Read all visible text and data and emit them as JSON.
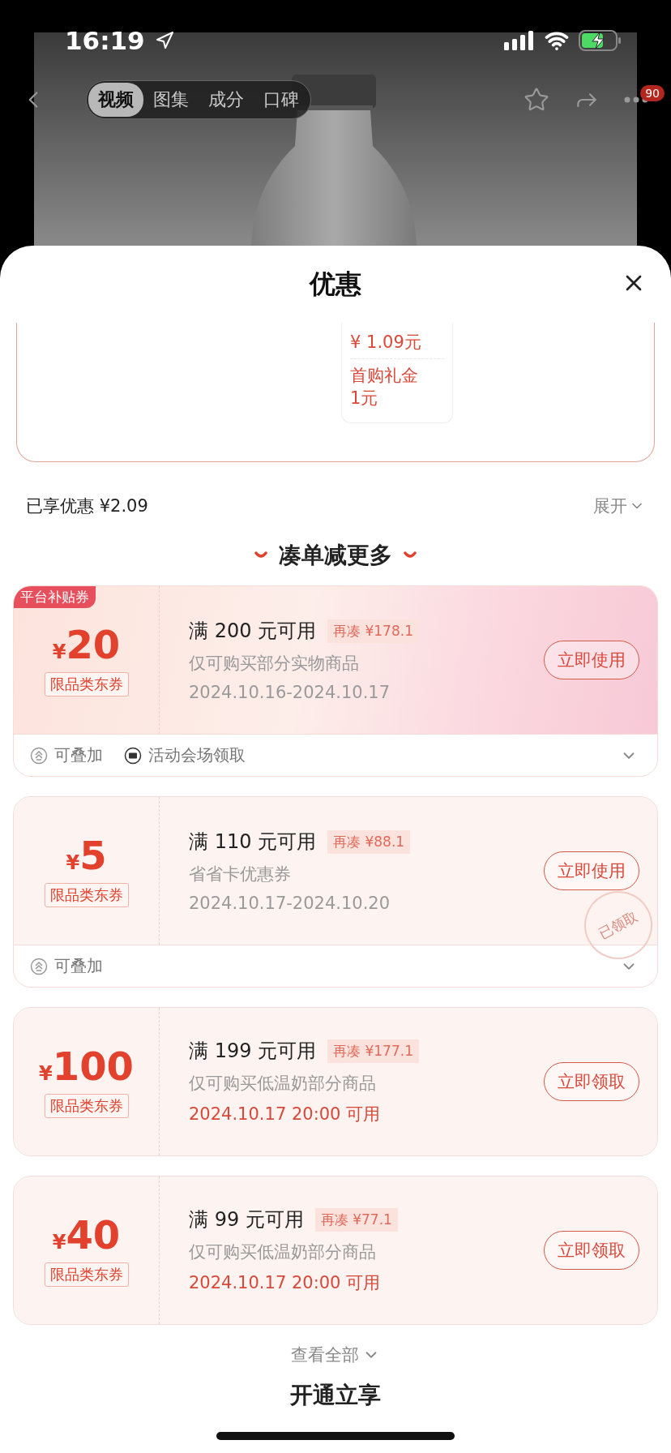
{
  "status_bar": {
    "time": "16:19"
  },
  "nav": {
    "tabs": [
      {
        "label": "视频",
        "selected": true
      },
      {
        "label": "图集",
        "selected": false
      },
      {
        "label": "成分",
        "selected": false
      },
      {
        "label": "口碑",
        "selected": false
      }
    ],
    "badge": "90"
  },
  "sheet": {
    "title": "优惠"
  },
  "price_breakdown": {
    "items": [
      {
        "lines": [
          "¥ 1.09元"
        ]
      },
      {
        "lines": [
          "首购礼金",
          "1元"
        ]
      }
    ]
  },
  "saved": {
    "label": "已享优惠 ¥2.09",
    "toggle": "展开"
  },
  "section_title": "凑单减更多",
  "coupons": [
    {
      "corner_tag": "平台补贴券",
      "gradient": true,
      "currency": "¥",
      "amount": "20",
      "category": "限品类东券",
      "title": "满 200 元可用",
      "gap": "再凑 ¥178.1",
      "desc": "仅可购买部分实物商品",
      "date": "2024.10.16-2024.10.17",
      "date_highlight": false,
      "action": "立即使用",
      "footer": [
        {
          "kind": "stack",
          "label": "可叠加"
        },
        {
          "kind": "venue",
          "label": "活动会场领取"
        }
      ]
    },
    {
      "gradient": false,
      "currency": "¥",
      "amount": "5",
      "category": "限品类东券",
      "title": "满 110 元可用",
      "gap": "再凑 ¥88.1",
      "desc": "省省卡优惠券",
      "date": "2024.10.17-2024.10.20",
      "date_highlight": false,
      "action": "立即使用",
      "stamp": "已领取",
      "footer": [
        {
          "kind": "stack",
          "label": "可叠加"
        }
      ]
    },
    {
      "gradient": false,
      "currency": "¥",
      "amount": "100",
      "category": "限品类东券",
      "title": "满 199 元可用",
      "gap": "再凑 ¥177.1",
      "desc": "仅可购买低温奶部分商品",
      "date": "2024.10.17 20:00 可用",
      "date_highlight": true,
      "action": "立即领取"
    },
    {
      "gradient": false,
      "currency": "¥",
      "amount": "40",
      "category": "限品类东券",
      "title": "满 99 元可用",
      "gap": "再凑 ¥77.1",
      "desc": "仅可购买低温奶部分商品",
      "date": "2024.10.17 20:00 可用",
      "date_highlight": true,
      "action": "立即领取"
    }
  ],
  "view_all": "查看全部",
  "next_section": "开通立享"
}
